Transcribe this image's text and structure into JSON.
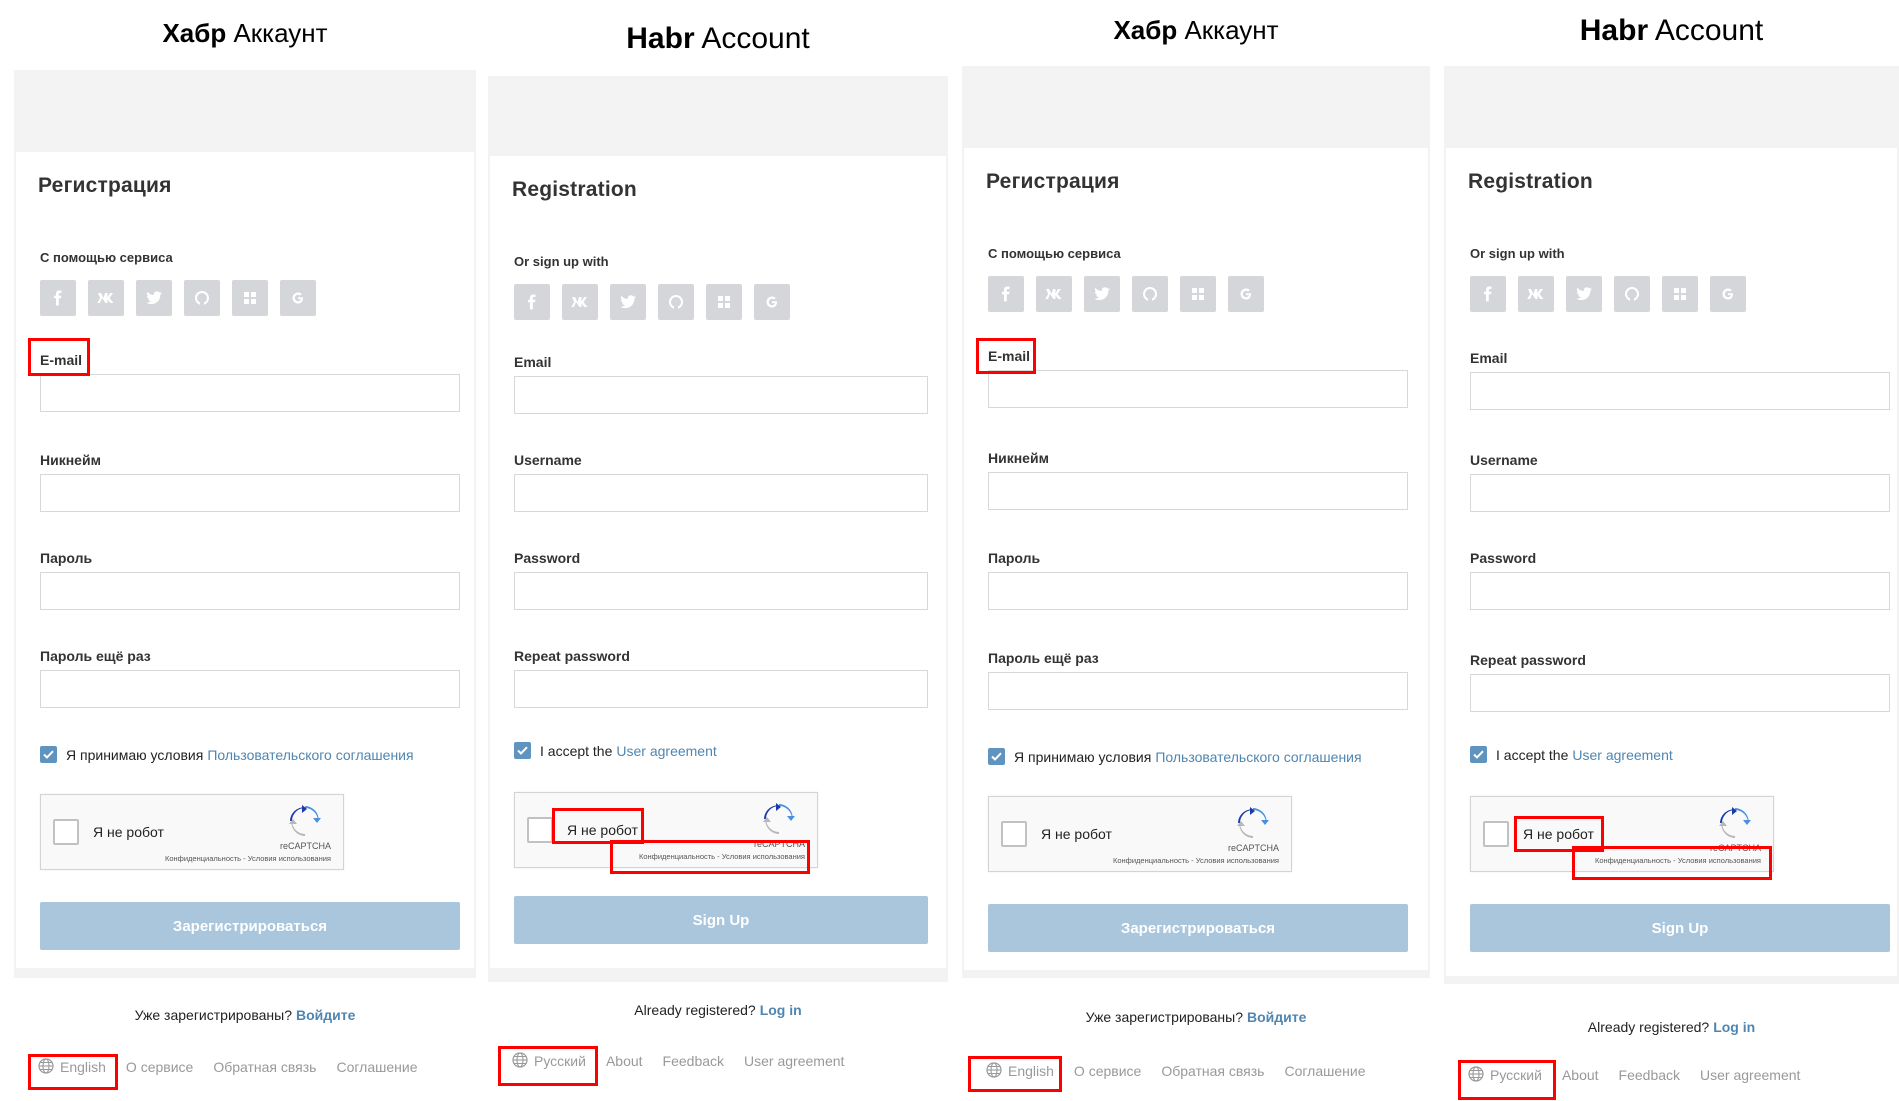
{
  "panels": [
    {
      "brand_bold": "Хабр",
      "brand_rest": "Аккаунт",
      "title": "Регистрация",
      "social_label": "С помощью сервиса",
      "fields": [
        "E-mail",
        "Никнейм",
        "Пароль",
        "Пароль ещё раз"
      ],
      "agree_text": "Я принимаю условия",
      "agree_link": "Пользовательского соглашения",
      "captcha_text": "Я не робот",
      "captcha_brand": "reCAPTCHA",
      "captcha_terms": "Конфиденциальность - Условия использования",
      "submit": "Зарегистрироваться",
      "login_text": "Уже зарегистрированы?",
      "login_link": "Войдите",
      "lang": "English",
      "footer_links": [
        "О сервисе",
        "Обратная связь",
        "Соглашение"
      ]
    },
    {
      "brand_bold": "Habr",
      "brand_rest": "Account",
      "title": "Registration",
      "social_label": "Or sign up with",
      "fields": [
        "Email",
        "Username",
        "Password",
        "Repeat password"
      ],
      "agree_text": "I accept the",
      "agree_link": "User agreement",
      "captcha_text": "Я не робот",
      "captcha_brand": "reCAPTCHA",
      "captcha_terms": "Конфиденциальность - Условия использования",
      "submit": "Sign Up",
      "login_text": "Already registered?",
      "login_link": "Log in",
      "lang": "Русский",
      "footer_links": [
        "About",
        "Feedback",
        "User agreement"
      ]
    },
    {
      "brand_bold": "Хабр",
      "brand_rest": "Аккаунт",
      "title": "Регистрация",
      "social_label": "С помощью сервиса",
      "fields": [
        "E-mail",
        "Никнейм",
        "Пароль",
        "Пароль ещё раз"
      ],
      "agree_text": "Я принимаю условия",
      "agree_link": "Пользовательского соглашения",
      "captcha_text": "Я не робот",
      "captcha_brand": "reCAPTCHA",
      "captcha_terms": "Конфиденциальность - Условия использования",
      "submit": "Зарегистрироваться",
      "login_text": "Уже зарегистрированы?",
      "login_link": "Войдите",
      "lang": "English",
      "footer_links": [
        "О сервисе",
        "Обратная связь",
        "Соглашение"
      ]
    },
    {
      "brand_bold": "Habr",
      "brand_rest": "Account",
      "title": "Registration",
      "social_label": "Or sign up with",
      "fields": [
        "Email",
        "Username",
        "Password",
        "Repeat password"
      ],
      "agree_text": "I accept the",
      "agree_link": "User agreement",
      "captcha_text": "Я не робот",
      "captcha_brand": "reCAPTCHA",
      "captcha_terms": "Конфиденциальность - Условия использования",
      "submit": "Sign Up",
      "login_text": "Already registered?",
      "login_link": "Log in",
      "lang": "Русский",
      "footer_links": [
        "About",
        "Feedback",
        "User agreement"
      ]
    }
  ],
  "social_icons": [
    "facebook-icon",
    "vk-icon",
    "twitter-icon",
    "github-icon",
    "microsoft-icon",
    "google-icon"
  ],
  "colors": {
    "link": "#4f86b1",
    "button": "#a9c6dc",
    "checkbox": "#5e94bf",
    "highlight": "#ff0000",
    "social_bg": "#d4d6d9"
  }
}
